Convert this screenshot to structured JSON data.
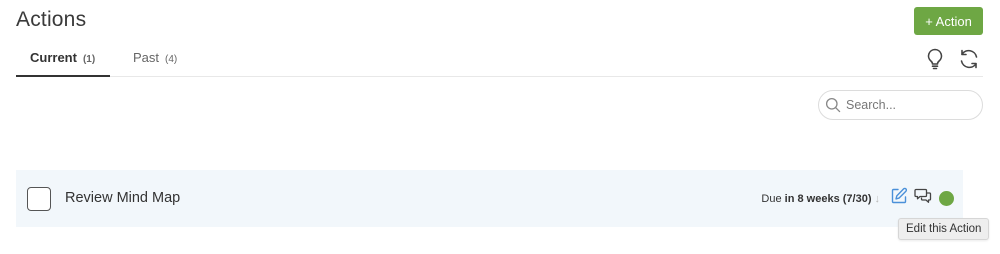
{
  "page": {
    "title": "Actions"
  },
  "toolbar": {
    "add_button_label": "+ Action"
  },
  "tabs": [
    {
      "label": "Current",
      "count": "(1)",
      "active": true
    },
    {
      "label": "Past",
      "count": "(4)",
      "active": false
    }
  ],
  "icons": {
    "lightbulb": "lightbulb-icon",
    "refresh": "refresh-icon",
    "search": "search-icon",
    "edit": "edit-icon",
    "comments": "comments-icon"
  },
  "search": {
    "placeholder": "Search...",
    "value": ""
  },
  "actions": [
    {
      "title": "Review Mind Map",
      "checked": false,
      "due_prefix": "Due",
      "due_bold": "in 8 weeks (7/30)",
      "due_arrow": "↓",
      "status_color": "#6ea744"
    }
  ],
  "tooltip": {
    "text": "Edit this Action"
  },
  "colors": {
    "accent": "#6ea744",
    "row_bg": "#f2f7fb",
    "edit_icon": "#4a90d9"
  }
}
